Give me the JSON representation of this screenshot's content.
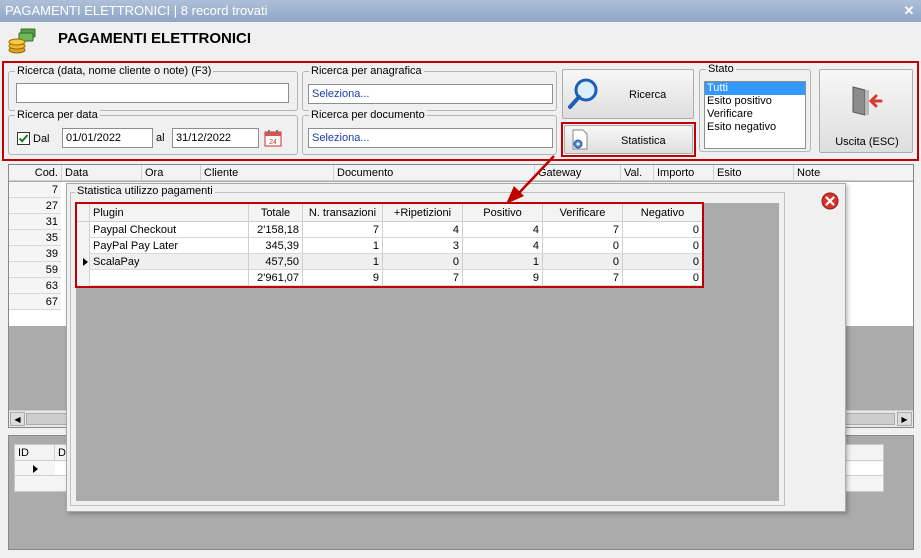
{
  "window": {
    "title": "PAGAMENTI ELETTRONICI | 8 record trovati",
    "close_glyph": "✕"
  },
  "app": {
    "title": "PAGAMENTI ELETTRONICI"
  },
  "search": {
    "general_label": "Ricerca (data, nome cliente o note) (F3)",
    "general_value": "",
    "date_label": "Ricerca per data",
    "dal_label": "Dal",
    "dal_checked": true,
    "date_from": "01/01/2022",
    "al_label": "al",
    "date_to": "31/12/2022",
    "anagrafica_label": "Ricerca per anagrafica",
    "anagrafica_value": "Seleziona...",
    "documento_label": "Ricerca per documento",
    "documento_value": "Seleziona...",
    "ricerca_button": "Ricerca",
    "statistica_button": "Statistica",
    "calendar_day": "24"
  },
  "stato": {
    "label": "Stato",
    "options": [
      "Tutti",
      "Esito positivo",
      "Verificare",
      "Esito negativo"
    ],
    "selected": "Tutti"
  },
  "exit_button": "Uscita (ESC)",
  "main_grid": {
    "columns": [
      "Cod.",
      "Data",
      "Ora",
      "Cliente",
      "Documento",
      "Gateway",
      "Val.",
      "Importo",
      "Esito",
      "Note"
    ],
    "codes": [
      "7",
      "27",
      "31",
      "35",
      "39",
      "59",
      "63",
      "67"
    ]
  },
  "detail_grid": {
    "columns": [
      "ID",
      "Da"
    ]
  },
  "stats_dialog": {
    "title": "Statistica utilizzo pagamenti",
    "columns": [
      "Plugin",
      "Totale",
      "N. transazioni",
      "+Ripetizioni",
      "Positivo",
      "Verificare",
      "Negativo"
    ],
    "rows": [
      [
        "Paypal Checkout",
        "2'158,18",
        "7",
        "4",
        "4",
        "7",
        "0"
      ],
      [
        "PayPal Pay Later",
        "345,39",
        "1",
        "3",
        "4",
        "0",
        "0"
      ],
      [
        "ScalaPay",
        "457,50",
        "1",
        "0",
        "1",
        "0",
        "0"
      ]
    ],
    "total_row": [
      "",
      "2'961,07",
      "9",
      "7",
      "9",
      "7",
      "0"
    ],
    "current_row_index": 2
  },
  "colors": {
    "accent_red": "#c00000",
    "selection_blue": "#3399ff",
    "link_blue": "#1a3da8"
  }
}
